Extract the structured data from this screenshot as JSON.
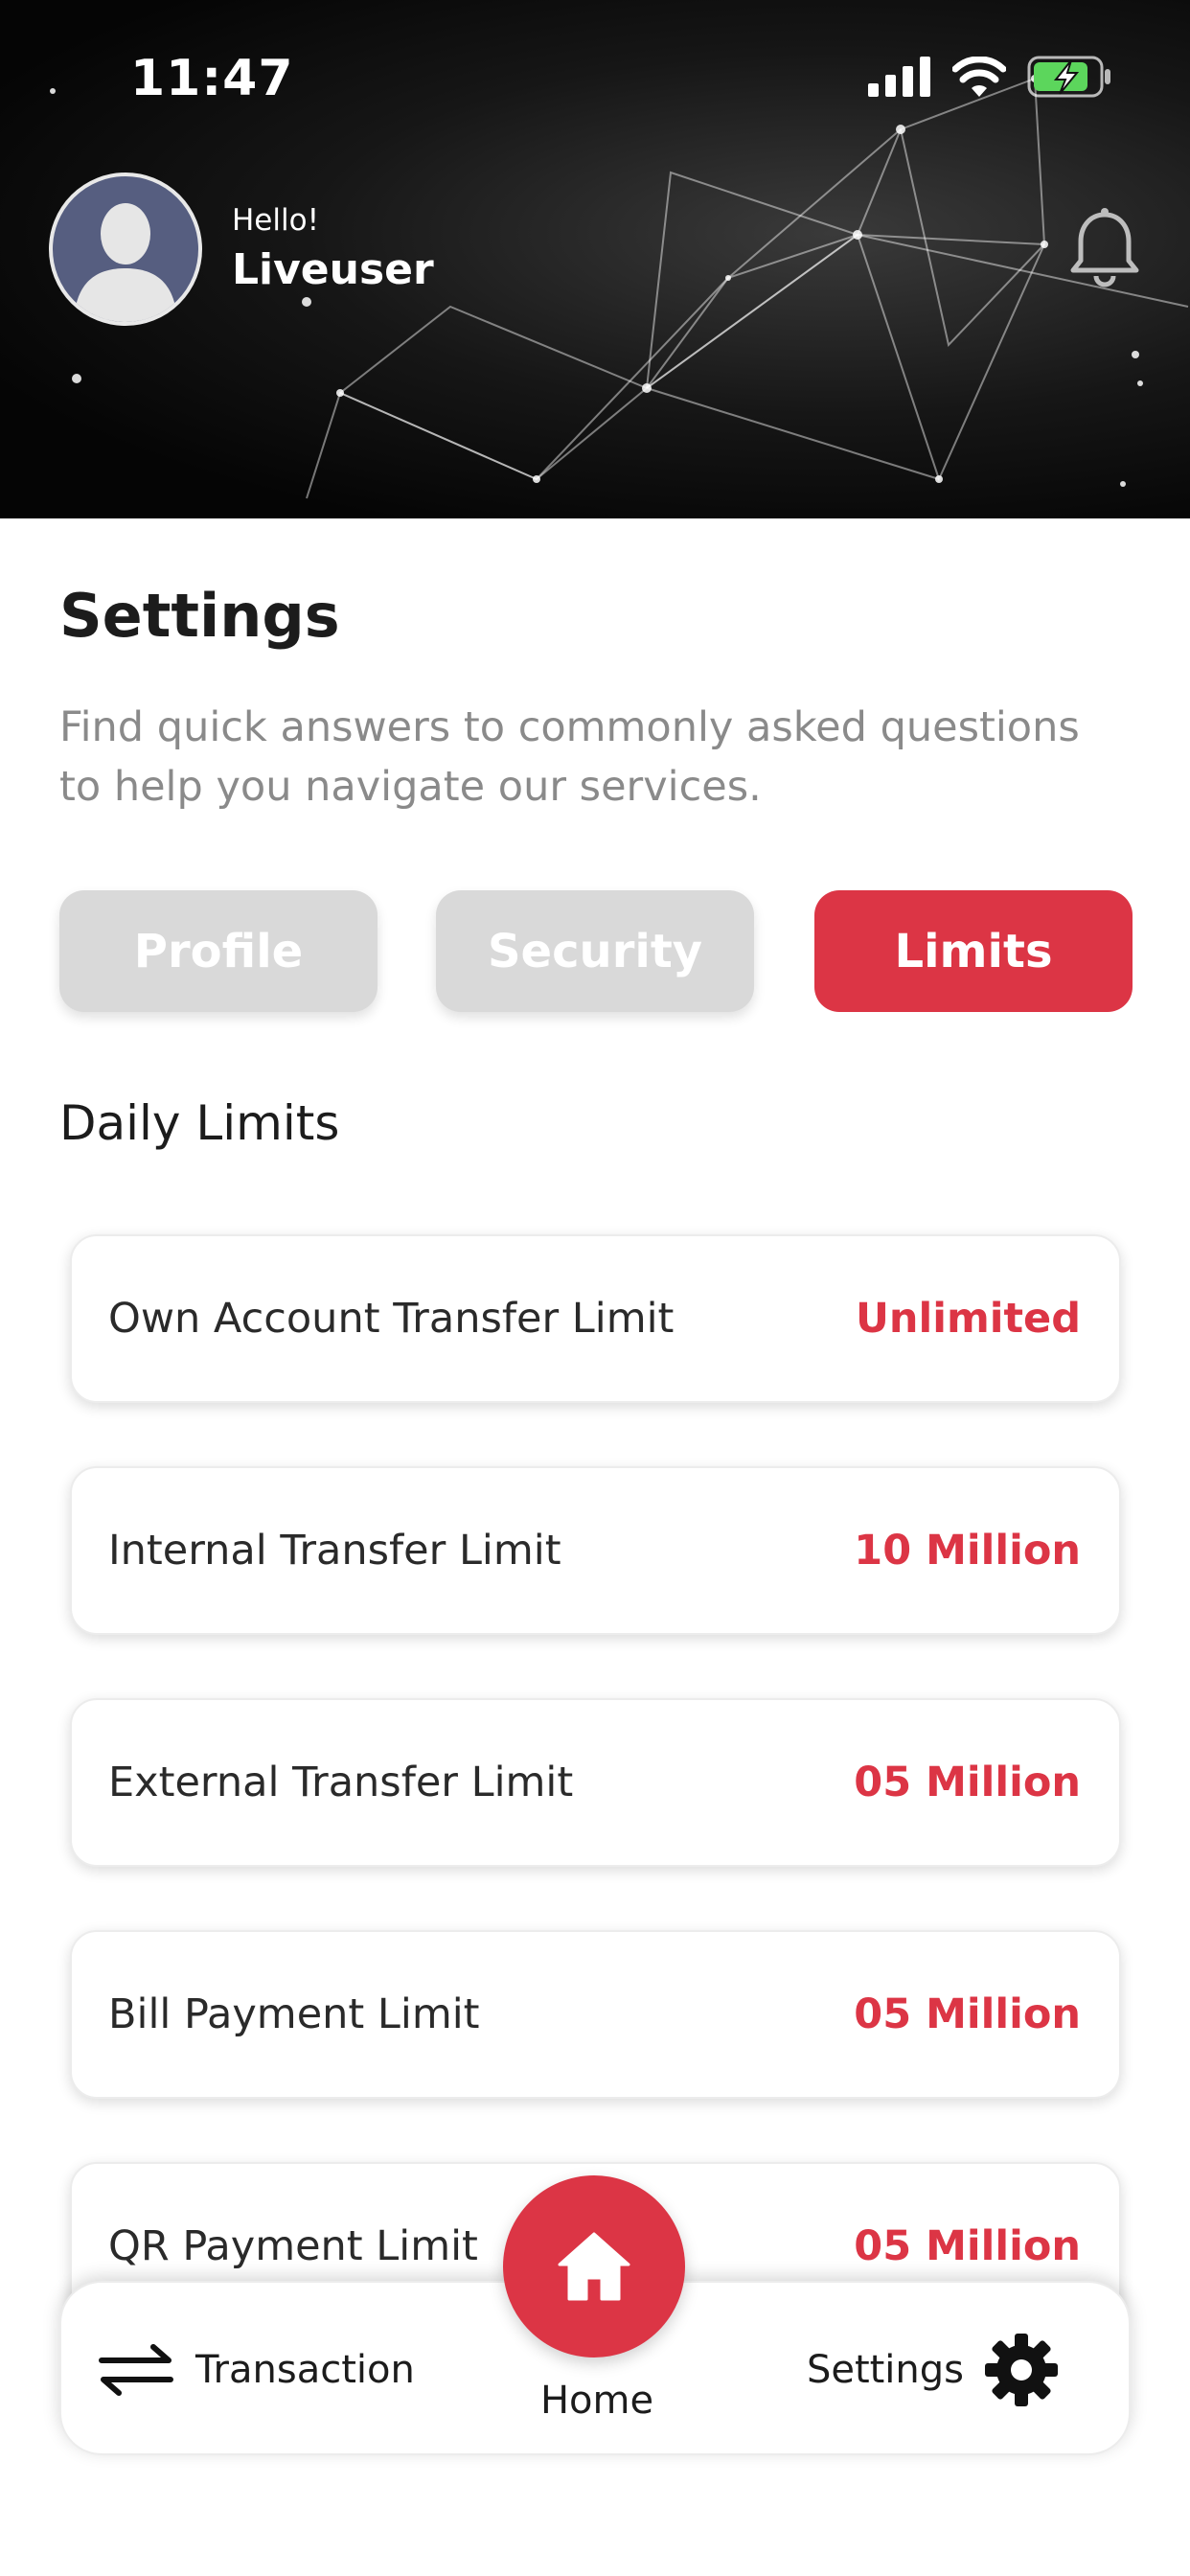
{
  "status_bar": {
    "time": "11:47"
  },
  "header": {
    "greeting": "Hello!",
    "username": "Liveuser"
  },
  "page": {
    "title": "Settings",
    "description": "Find quick answers to commonly asked questions to help you navigate our services."
  },
  "tabs": [
    {
      "label": "Profile",
      "active": false
    },
    {
      "label": "Security",
      "active": false
    },
    {
      "label": "Limits",
      "active": true
    }
  ],
  "limits": {
    "section_title": "Daily Limits",
    "items": [
      {
        "label": "Own Account Transfer Limit",
        "value": "Unlimited"
      },
      {
        "label": "Internal Transfer Limit",
        "value": "10 Million"
      },
      {
        "label": "External Transfer Limit",
        "value": "05 Million"
      },
      {
        "label": "Bill Payment Limit",
        "value": "05 Million"
      },
      {
        "label": "QR Payment Limit",
        "value": "05 Million"
      }
    ]
  },
  "bottom_nav": {
    "transaction_label": "Transaction",
    "home_label": "Home",
    "settings_label": "Settings"
  },
  "colors": {
    "accent": "#dc3545",
    "tab_inactive": "#d9d9d9",
    "battery_green": "#5cd65c"
  },
  "icons": [
    "signal-icon",
    "wifi-icon",
    "battery-charging-icon",
    "user-avatar-icon",
    "bell-icon",
    "transfer-arrows-icon",
    "home-icon",
    "gear-icon"
  ]
}
